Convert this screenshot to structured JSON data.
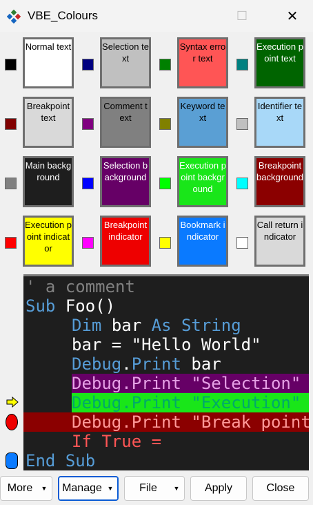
{
  "window": {
    "title": "VBE_Colours",
    "maximize_glyph": "☐",
    "close_glyph": "✕"
  },
  "grid": [
    {
      "swatch": "#000000",
      "label": "Normal text",
      "bg": "#ffffff",
      "fg": "#000000"
    },
    {
      "swatch": "#000080",
      "label": "Selection text",
      "bg": "#c0c0c0",
      "fg": "#000000"
    },
    {
      "swatch": "#008000",
      "label": "Syntax error text",
      "bg": "#ff5555",
      "fg": "#000000"
    },
    {
      "swatch": "#008080",
      "label": "Execution point text",
      "bg": "#006400",
      "fg": "#ffffff"
    },
    {
      "swatch": "#800000",
      "label": "Breakpoint text",
      "bg": "#d9d9d9",
      "fg": "#000000"
    },
    {
      "swatch": "#800080",
      "label": "Comment text",
      "bg": "#808080",
      "fg": "#000000"
    },
    {
      "swatch": "#808000",
      "label": "Keyword text",
      "bg": "#5a9fd4",
      "fg": "#000000"
    },
    {
      "swatch": "#c0c0c0",
      "label": "Identifier text",
      "bg": "#a8d8f8",
      "fg": "#000000"
    },
    {
      "swatch": "#808080",
      "label": "Main background",
      "bg": "#1e1e1e",
      "fg": "#ffffff"
    },
    {
      "swatch": "#0000ff",
      "label": "Selection background",
      "bg": "#660066",
      "fg": "#ffffff"
    },
    {
      "swatch": "#00ff00",
      "label": "Execution point background",
      "bg": "#19e619",
      "fg": "#ffffff"
    },
    {
      "swatch": "#00ffff",
      "label": "Breakpoint background",
      "bg": "#8b0000",
      "fg": "#ffffff"
    },
    {
      "swatch": "#ff0000",
      "label": "Execution point indicator",
      "bg": "#ffff00",
      "fg": "#000000"
    },
    {
      "swatch": "#ff00ff",
      "label": "Breakpoint indicator",
      "bg": "#ee0000",
      "fg": "#ffffff"
    },
    {
      "swatch": "#ffff00",
      "label": "Bookmark indicator",
      "bg": "#0a7aff",
      "fg": "#ffffff"
    },
    {
      "swatch": "#ffffff",
      "label": "Call return indicator",
      "bg": "#d9d9d9",
      "fg": "#000000"
    }
  ],
  "code": {
    "line1": {
      "comment": "' a comment"
    },
    "line2": {
      "kw": "Sub",
      "ident": "Foo()"
    },
    "line3": {
      "kw1": "Dim",
      "ident": "bar",
      "kw2": "As String"
    },
    "line4": {
      "text": "bar = \"Hello World\""
    },
    "line5": {
      "obj": "Debug",
      "dot": ".",
      "kw": "Print",
      "ident": "bar"
    },
    "line6": {
      "text": "Debug.Print \"Selection\""
    },
    "line7": {
      "text": "Debug.Print \"Execution\""
    },
    "line8": {
      "text": "Debug.Print \"Break point\""
    },
    "line9": {
      "text": "If True ="
    },
    "line10": {
      "kw1": "End",
      "kw2": "Sub"
    }
  },
  "buttons": {
    "more": "More",
    "manage": "Manage",
    "file": "File",
    "apply": "Apply",
    "close": "Close"
  },
  "colors": {
    "keyword": "#569cd6",
    "identifier": "#ffffff",
    "comment": "#808080",
    "selection_bg": "#660066",
    "selection_fg": "#e6a0e6",
    "exec_bg": "#19e619",
    "exec_fg": "#00ffaa",
    "break_bg": "#8b0000",
    "break_fg": "#ff9999",
    "syntax_error": "#ff5555"
  }
}
